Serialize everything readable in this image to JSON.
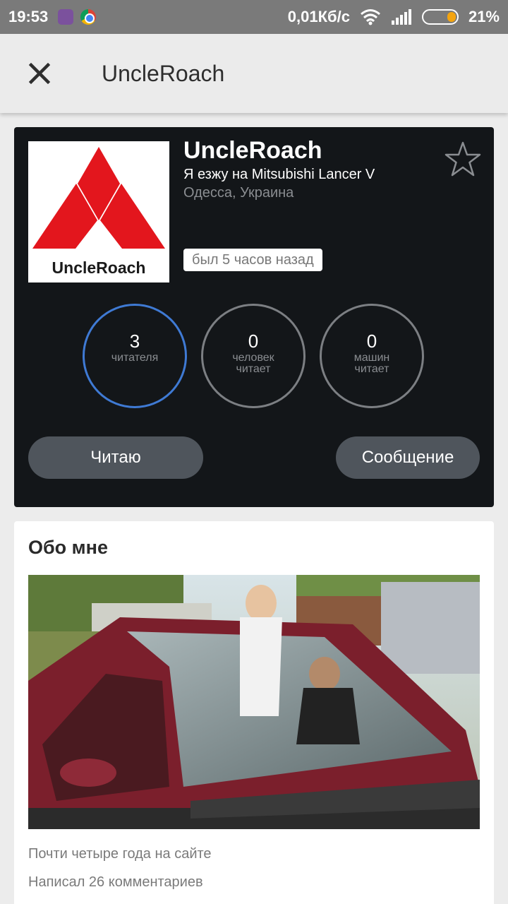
{
  "status_bar": {
    "time": "19:53",
    "network_speed": "0,01Кб/с",
    "battery_percent": "21%",
    "battery_level": 0.21,
    "icons": [
      "viber-icon",
      "chrome-icon",
      "wifi-icon",
      "signal-icon",
      "battery-icon"
    ]
  },
  "appbar": {
    "title": "UncleRoach",
    "close_icon": "close-icon"
  },
  "profile": {
    "avatar_label": "UncleRoach",
    "name": "UncleRoach",
    "car": "Я езжу на Mitsubishi Lancer V",
    "location": "Одесса, Украина",
    "last_seen": "был 5 часов назад",
    "favorite_icon": "star-outline-icon",
    "stats": [
      {
        "value": "3",
        "label": "читателя",
        "active": true
      },
      {
        "value": "0",
        "label": "человек читает",
        "active": false
      },
      {
        "value": "0",
        "label": "машин читает",
        "active": false
      }
    ],
    "buttons": {
      "follow": "Читаю",
      "message": "Сообщение"
    }
  },
  "about": {
    "title": "Обо мне",
    "lines": [
      "Почти четыре года на сайте",
      "Написал 26 комментариев"
    ]
  },
  "colors": {
    "card_bg": "#131619",
    "accent_ring": "#3f7ad4",
    "button_bg": "#4f555c",
    "logo_red": "#e3161d"
  }
}
